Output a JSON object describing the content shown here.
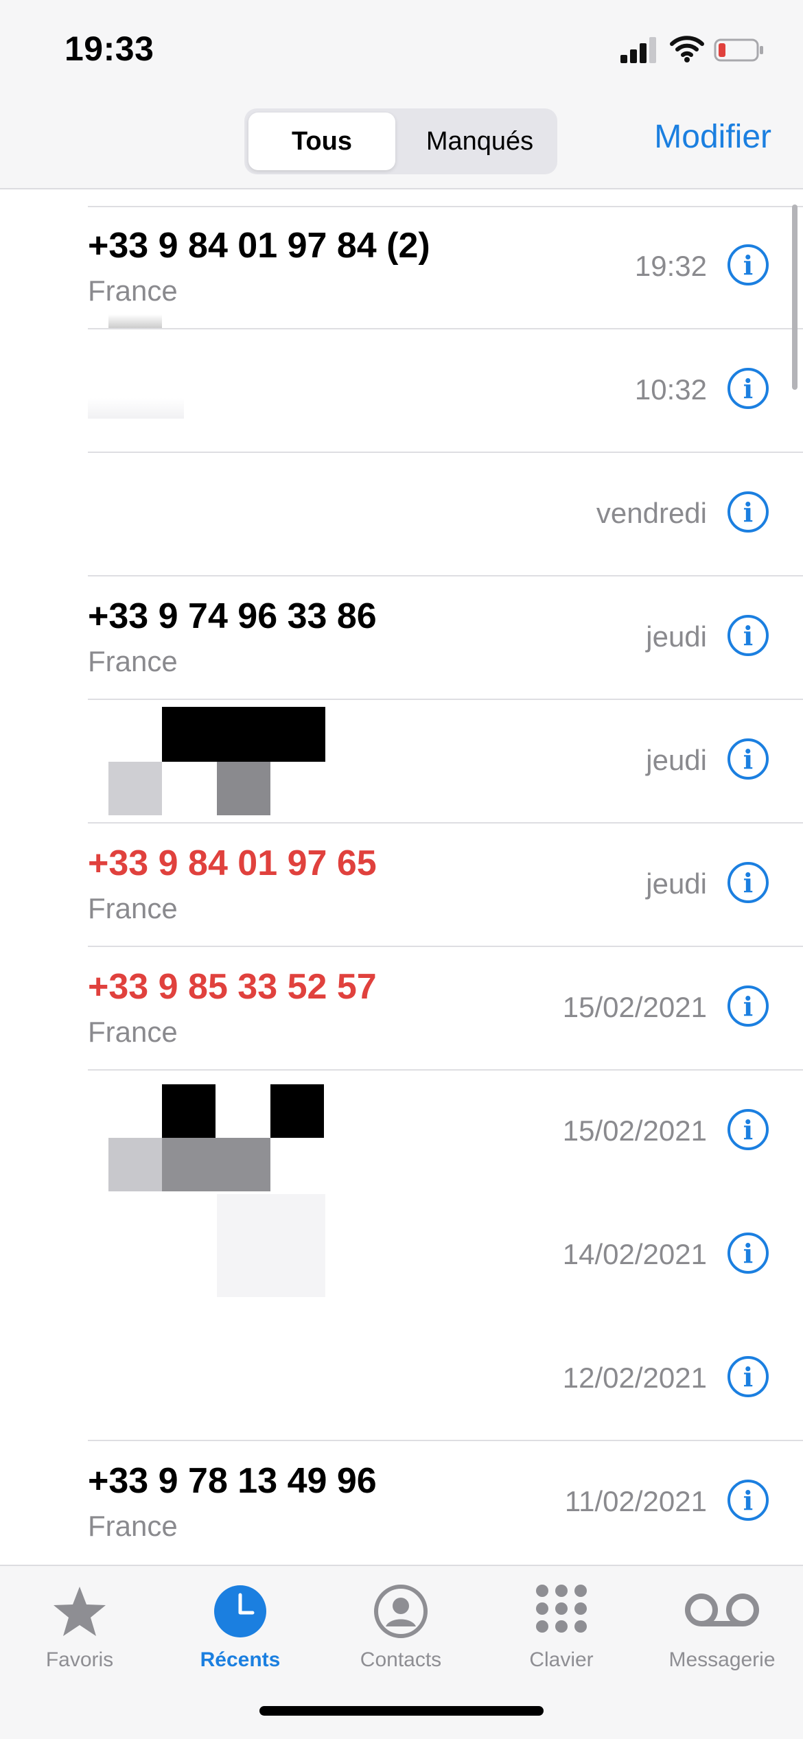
{
  "status_bar": {
    "time": "19:33",
    "icons": [
      "signal-icon",
      "wifi-icon",
      "battery-low-icon"
    ],
    "battery_color": "#e0413d"
  },
  "header": {
    "segments": [
      {
        "label": "Tous",
        "selected": true
      },
      {
        "label": "Manqués",
        "selected": false
      }
    ],
    "modify_label": "Modifier"
  },
  "calls": [
    {
      "number": "+33 9 84 01 97 84 (2)",
      "sub": "France",
      "time": "19:32",
      "missed": false
    },
    {
      "number": "",
      "sub": "",
      "time": "10:32",
      "missed": false,
      "redacted": true
    },
    {
      "number": "",
      "sub": "",
      "time": "vendredi",
      "missed": false,
      "redacted": true
    },
    {
      "number": "+33 9 74 96 33 86",
      "sub": "France",
      "time": "jeudi",
      "missed": false
    },
    {
      "number": "",
      "sub": "",
      "time": "jeudi",
      "missed": false,
      "redacted": true
    },
    {
      "number": "+33 9 84 01 97 65",
      "sub": "France",
      "time": "jeudi",
      "missed": true
    },
    {
      "number": "+33 9 85 33 52 57",
      "sub": "France",
      "time": "15/02/2021",
      "missed": true
    },
    {
      "number": "",
      "sub": "",
      "time": "15/02/2021",
      "missed": false,
      "redacted": true
    },
    {
      "number": "",
      "sub": "",
      "time": "14/02/2021",
      "missed": false,
      "redacted": true
    },
    {
      "number": "",
      "sub": "",
      "time": "12/02/2021",
      "missed": false,
      "redacted": true
    },
    {
      "number": "+33 9 78 13 49 96",
      "sub": "France",
      "time": "11/02/2021",
      "missed": false
    }
  ],
  "tabs": [
    {
      "label": "Favoris",
      "icon": "star-icon",
      "active": false
    },
    {
      "label": "Récents",
      "icon": "clock-icon",
      "active": true
    },
    {
      "label": "Contacts",
      "icon": "person-circle-icon",
      "active": false
    },
    {
      "label": "Clavier",
      "icon": "keypad-icon",
      "active": false
    },
    {
      "label": "Messagerie",
      "icon": "voicemail-icon",
      "active": false
    }
  ],
  "colors": {
    "accent": "#1b7fe0",
    "missed": "#e0413d",
    "secondary_text": "#8a8a8e",
    "tab_inactive": "#8e8e93"
  }
}
